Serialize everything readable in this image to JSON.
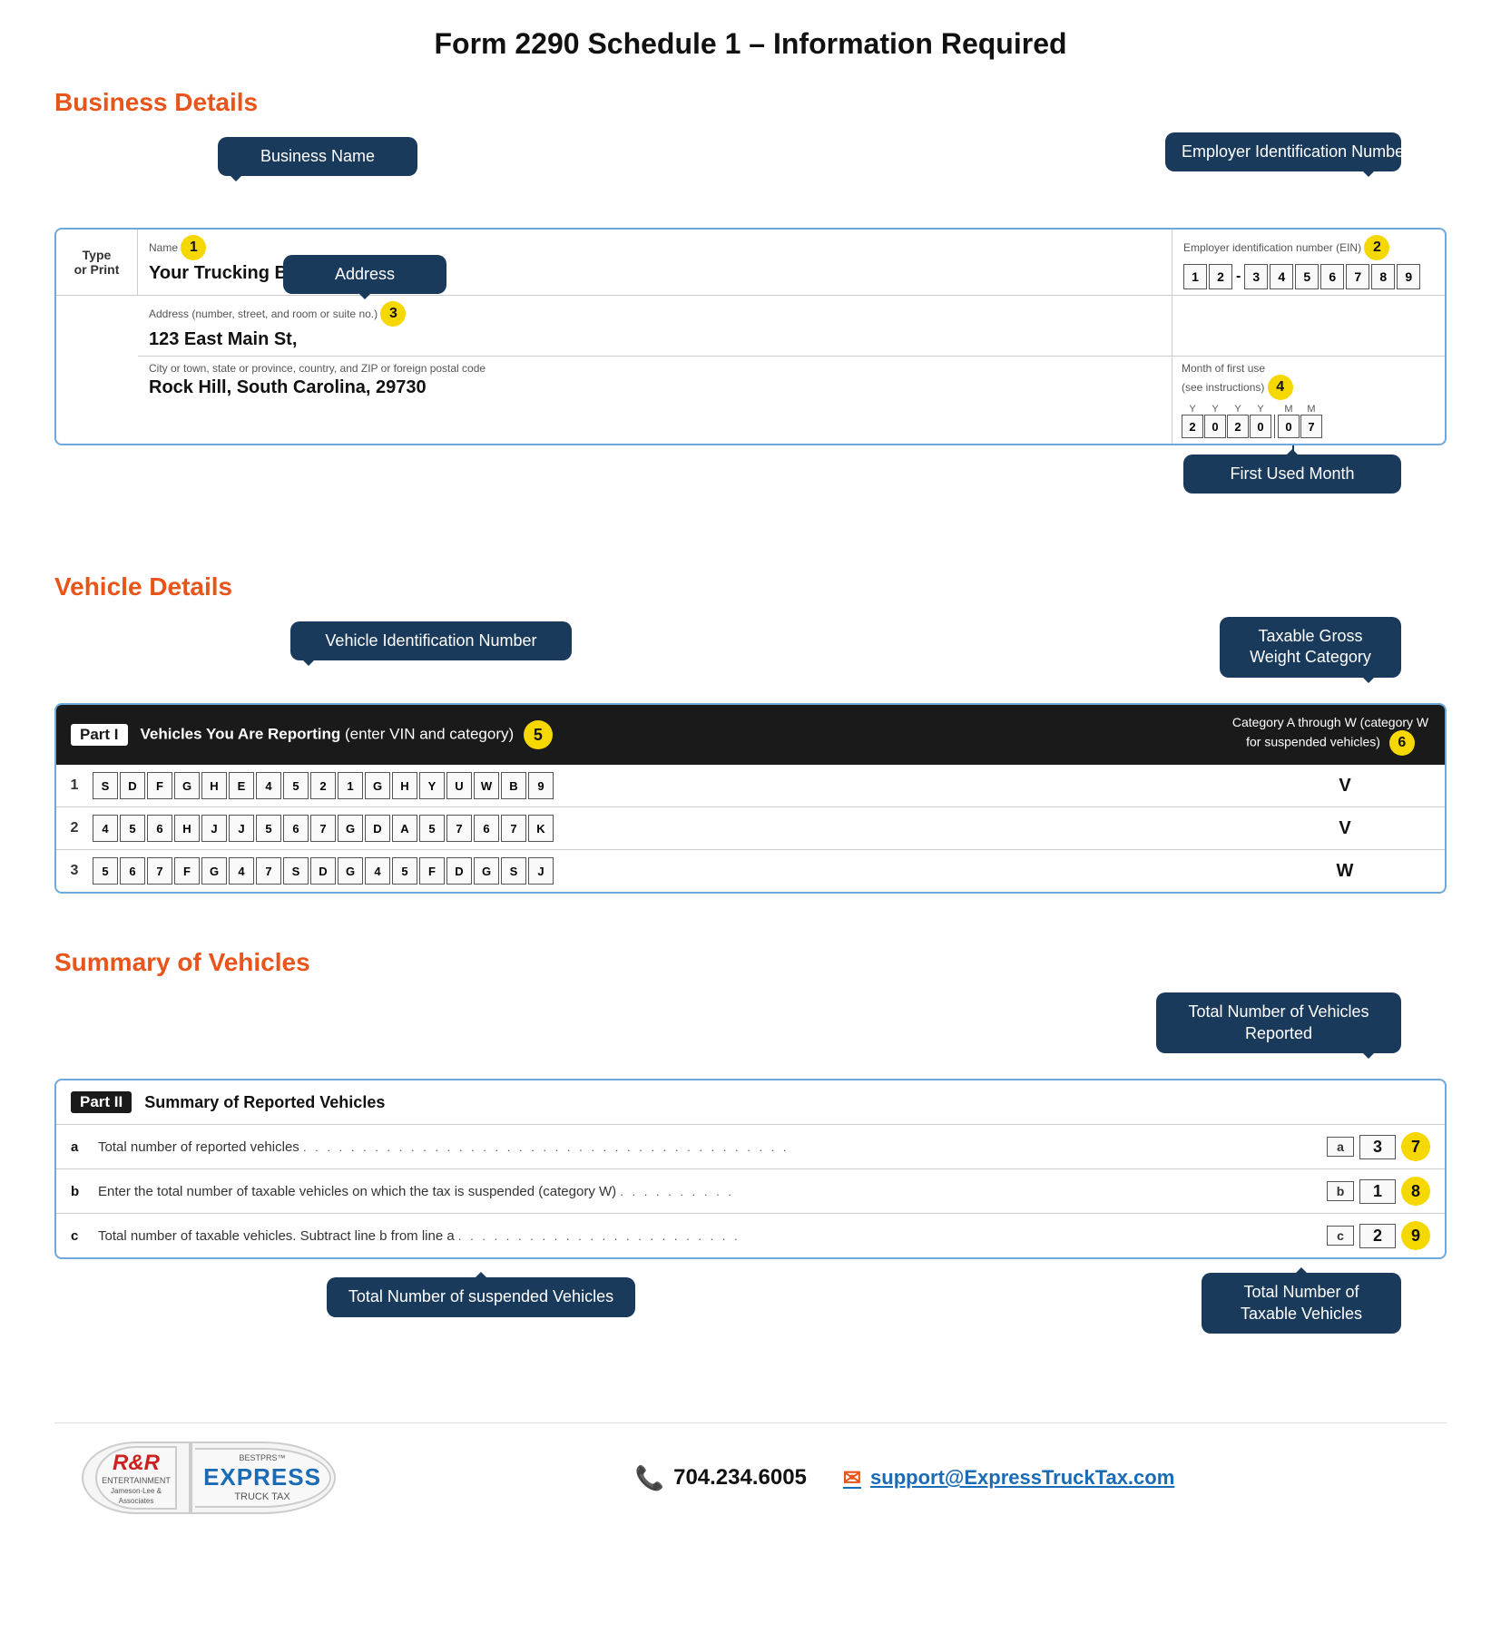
{
  "page": {
    "title": "Form 2290 Schedule 1 – Information Required"
  },
  "business": {
    "section_label": "Business Details",
    "tooltips": {
      "business_name": "Business Name",
      "ein": "Employer Identification Number",
      "address": "Address",
      "first_used": "First Used Month"
    },
    "name_label": "Name",
    "name_badge": "1",
    "ein_label": "Employer identification number (EIN)",
    "ein_badge": "2",
    "ein_digits": [
      "1",
      "2",
      "-",
      "3",
      "4",
      "5",
      "6",
      "7",
      "8",
      "9"
    ],
    "name_value": "Your Trucking Business",
    "address_label": "Address (number, street, and room or suite no.)",
    "address_badge": "3",
    "address_value": "123 East Main St,",
    "city_label": "City or town, state or province, country, and ZIP or foreign postal code",
    "city_value": "Rock Hill, South Carolina, 29730",
    "type_or_print": "Type\nor Print",
    "month_label": "Month of first use\n(see instructions)",
    "month_badge": "4",
    "month_labels_top": [
      "Y",
      "Y",
      "Y",
      "Y",
      "M",
      "M"
    ],
    "month_values": [
      "2",
      "0",
      "2",
      "0",
      "0",
      "7"
    ]
  },
  "vehicle": {
    "section_label": "Vehicle Details",
    "tooltips": {
      "vin": "Vehicle Identification Number",
      "tgw": "Taxable Gross Weight Category"
    },
    "part_label": "Part I",
    "header_text": "Vehicles You Are Reporting",
    "header_sub": "(enter VIN and category)",
    "header_badge": "5",
    "category_header": "Category A through W (category W for suspended vehicles)",
    "category_badge": "6",
    "rows": [
      {
        "num": "1",
        "vin": [
          "S",
          "D",
          "F",
          "G",
          "H",
          "E",
          "4",
          "5",
          "2",
          "1",
          "G",
          "H",
          "Y",
          "U",
          "W",
          "B",
          "9"
        ],
        "category": "V"
      },
      {
        "num": "2",
        "vin": [
          "4",
          "5",
          "6",
          "H",
          "J",
          "J",
          "5",
          "6",
          "7",
          "G",
          "D",
          "A",
          "5",
          "7",
          "6",
          "7",
          "K"
        ],
        "category": "V"
      },
      {
        "num": "3",
        "vin": [
          "5",
          "6",
          "7",
          "F",
          "G",
          "4",
          "7",
          "S",
          "D",
          "G",
          "4",
          "5",
          "F",
          "D",
          "G",
          "S",
          "J"
        ],
        "category": "W"
      }
    ]
  },
  "summary": {
    "section_label": "Summary of Vehicles",
    "tooltips": {
      "total_vehicles": "Total Number of Vehicles Reported",
      "suspended": "Total Number of suspended Vehicles",
      "taxable": "Total Number of Taxable Vehicles"
    },
    "part_label": "Part II",
    "header_text": "Summary of Reported Vehicles",
    "rows": [
      {
        "letter": "a",
        "text": "Total number of reported vehicles",
        "label": "a",
        "value": "3",
        "badge": "7"
      },
      {
        "letter": "b",
        "text": "Enter the total number of taxable vehicles on which the tax is suspended (category W)",
        "label": "b",
        "value": "1",
        "badge": "8"
      },
      {
        "letter": "c",
        "text": "Total number of taxable vehicles. Subtract line b from line a",
        "label": "c",
        "value": "2",
        "badge": "9"
      }
    ]
  },
  "footer": {
    "rr_logo_text": "R&R",
    "rr_sub": "ENTERTAINMENT\nJameson-Lee & Associates",
    "express_logo_text": "EXPRESS",
    "express_sub": "BESTPRS™ TRUCK TAX",
    "phone": "704.234.6005",
    "email": "support@ExpressTruckTax.com"
  }
}
